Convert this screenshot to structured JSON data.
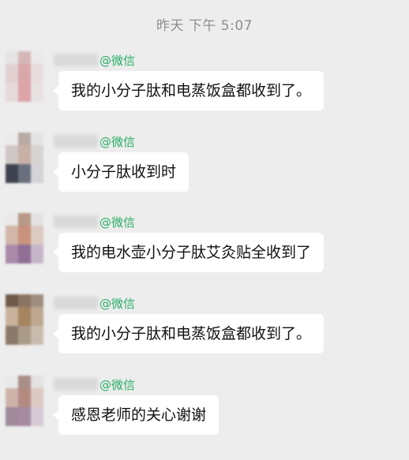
{
  "header": {
    "timestamp": "昨天 下午 5:07"
  },
  "messages": [
    {
      "source_tag": "@微信",
      "text": "我的小分子肽和电蒸饭盒都收到了。",
      "avatar_colors": [
        "#e6e3e4",
        "#d5b6b8",
        "#ece9ea",
        "#e3d1d2",
        "#d9a7aa",
        "#e9dcdd",
        "#e5d9da",
        "#dca3a8",
        "#e8e1e2"
      ]
    },
    {
      "source_tag": "@微信",
      "text": "小分子肽收到时",
      "avatar_colors": [
        "#ecebeb",
        "#b9aaa6",
        "#e4e3e3",
        "#cfc7c6",
        "#c9b0a6",
        "#d8d4d3",
        "#3f4350",
        "#6a6f7d",
        "#d4d4d8"
      ]
    },
    {
      "source_tag": "@微信",
      "text": "我的电水壶小分子肽艾灸贴全收到了",
      "avatar_colors": [
        "#eae8e8",
        "#b89887",
        "#e3e1e1",
        "#d2b7a8",
        "#c8927d",
        "#dccac0",
        "#a98aa9",
        "#8f6f94",
        "#c7b5c9"
      ]
    },
    {
      "source_tag": "@微信",
      "text": "我的小分子肽和电蒸饭盒都收到了。",
      "avatar_colors": [
        "#6e5a4b",
        "#8c7462",
        "#9f8d7f",
        "#c8b29c",
        "#a5845f",
        "#bda88f",
        "#8a7a6a",
        "#aa9a88",
        "#c9bcae"
      ]
    },
    {
      "source_tag": "@微信",
      "text": "感恩老师的关心谢谢",
      "avatar_colors": [
        "#e9e8e8",
        "#a88e86",
        "#e3e1e1",
        "#cdb3aa",
        "#b38a80",
        "#dcc9c3",
        "#9f8a9a",
        "#a68aa0",
        "#d6cad4"
      ]
    }
  ]
}
